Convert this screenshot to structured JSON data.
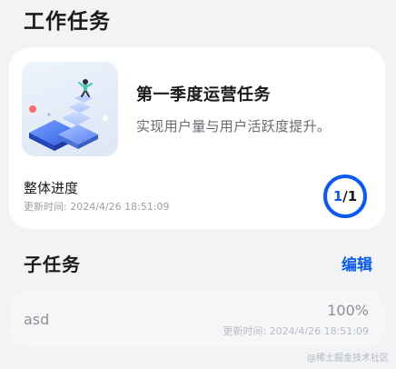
{
  "page": {
    "title": "工作任务"
  },
  "task": {
    "title": "第一季度运营任务",
    "description": "实现用户量与用户活跃度提升。",
    "cover_image": "operations-illustration",
    "progress_label": "整体进度",
    "updated": "更新时间: 2024/4/26 18:51:09",
    "progress": {
      "done": "1",
      "separator": "/",
      "total": "1",
      "fraction": 1.0
    }
  },
  "subtasks": {
    "section_title": "子任务",
    "edit_label": "编辑",
    "items": [
      {
        "name": "asd",
        "percent": "100%",
        "updated": "更新时间: 2024/4/26 18:51:09"
      }
    ]
  },
  "watermark": "@稀土掘金技术社区",
  "colors": {
    "accent": "#0a59f7",
    "background": "#f1f3f5",
    "card": "#ffffff"
  }
}
